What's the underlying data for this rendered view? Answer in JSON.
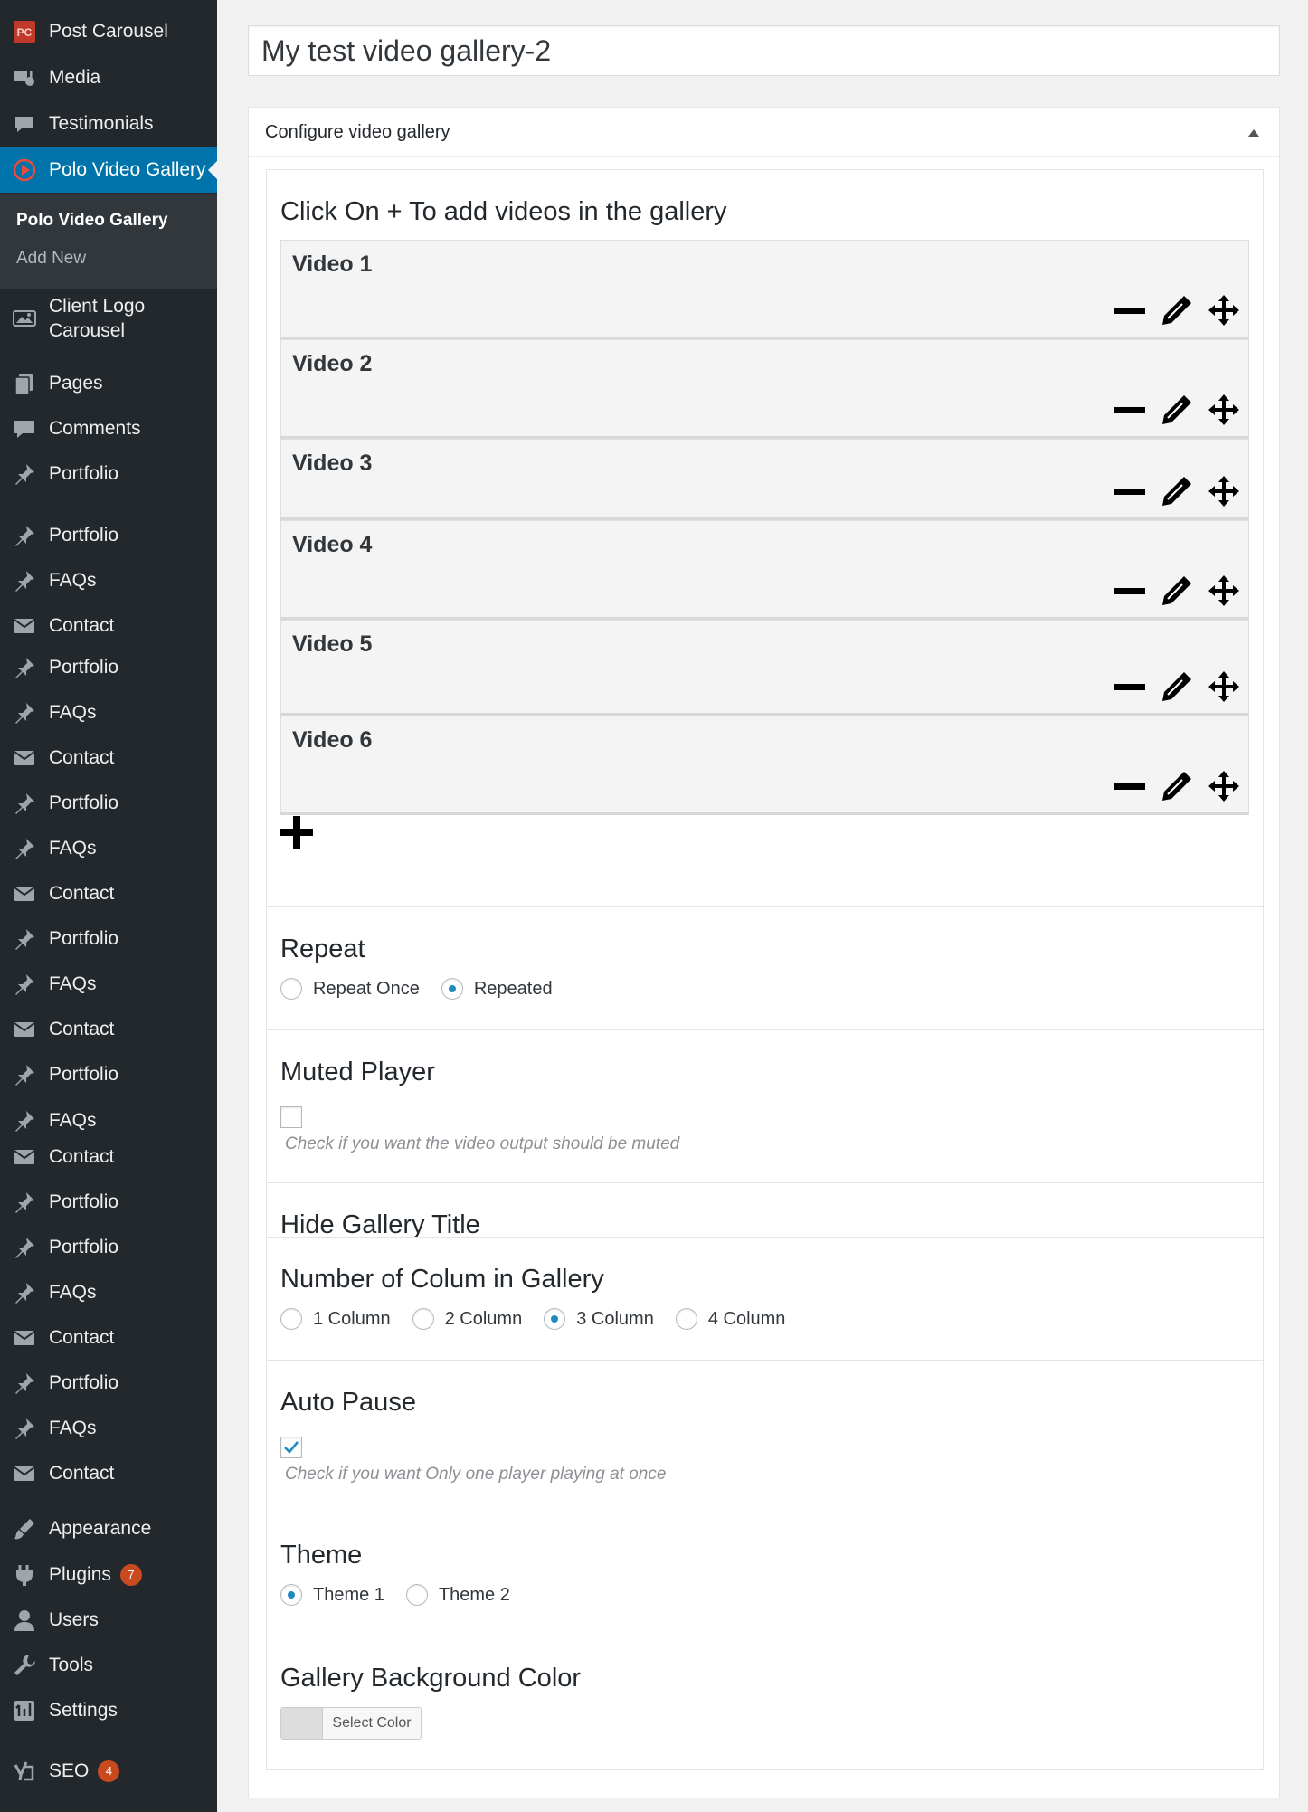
{
  "sidebar": {
    "items": [
      {
        "label": "Post Carousel",
        "icon": "pc-logo-icon"
      },
      {
        "label": "Media",
        "icon": "media-icon"
      },
      {
        "label": "Testimonials",
        "icon": "testimonials-icon"
      },
      {
        "label": "Polo Video Gallery",
        "icon": "play-circle-icon",
        "active": true
      },
      {
        "label": "Client Logo Carousel",
        "icon": "image-gallery-icon"
      },
      {
        "label": "Pages",
        "icon": "pages-icon"
      },
      {
        "label": "Comments",
        "icon": "comment-icon"
      },
      {
        "label": "Portfolio",
        "icon": "pin-icon"
      },
      {
        "label": "Portfolio",
        "icon": "pin-icon"
      },
      {
        "label": "FAQs",
        "icon": "pin-icon"
      },
      {
        "label": "Contact",
        "icon": "mail-icon"
      },
      {
        "label": "Portfolio",
        "icon": "pin-icon"
      },
      {
        "label": "FAQs",
        "icon": "pin-icon"
      },
      {
        "label": "Contact",
        "icon": "mail-icon"
      },
      {
        "label": "Portfolio",
        "icon": "pin-icon"
      },
      {
        "label": "FAQs",
        "icon": "pin-icon"
      },
      {
        "label": "Contact",
        "icon": "mail-icon"
      },
      {
        "label": "Portfolio",
        "icon": "pin-icon"
      },
      {
        "label": "FAQs",
        "icon": "pin-icon"
      },
      {
        "label": "Contact",
        "icon": "mail-icon"
      },
      {
        "label": "Portfolio",
        "icon": "pin-icon"
      },
      {
        "label": "FAQs",
        "icon": "pin-icon"
      },
      {
        "label": "Contact",
        "icon": "mail-icon"
      },
      {
        "label": "Portfolio",
        "icon": "pin-icon"
      },
      {
        "label": "Portfolio",
        "icon": "pin-icon"
      },
      {
        "label": "FAQs",
        "icon": "pin-icon"
      },
      {
        "label": "Contact",
        "icon": "mail-icon"
      },
      {
        "label": "Portfolio",
        "icon": "pin-icon"
      },
      {
        "label": "FAQs",
        "icon": "pin-icon"
      },
      {
        "label": "Contact",
        "icon": "mail-icon"
      },
      {
        "label": "Appearance",
        "icon": "brush-icon"
      },
      {
        "label": "Plugins",
        "icon": "plugin-icon",
        "badge": "7"
      },
      {
        "label": "Users",
        "icon": "user-icon"
      },
      {
        "label": "Tools",
        "icon": "wrench-icon"
      },
      {
        "label": "Settings",
        "icon": "settings-icon"
      },
      {
        "label": "SEO",
        "icon": "yoast-icon",
        "badge": "4"
      }
    ],
    "submenu": [
      {
        "label": "Polo Video Gallery",
        "current": true
      },
      {
        "label": "Add New"
      }
    ]
  },
  "post_title": "My test video gallery-2",
  "postbox": {
    "title": "Configure video gallery"
  },
  "videos": {
    "heading": "Click On + To add videos in the gallery",
    "items": [
      "Video 1",
      "Video 2",
      "Video 3",
      "Video 4",
      "Video 5",
      "Video 6"
    ]
  },
  "repeat": {
    "title": "Repeat",
    "options": [
      {
        "label": "Repeat Once",
        "checked": false
      },
      {
        "label": "Repeated",
        "checked": true
      }
    ]
  },
  "muted": {
    "title": "Muted Player",
    "checked": false,
    "help": "Check if you want the video output should be muted"
  },
  "hide_title": {
    "title": "Hide Gallery Title"
  },
  "columns": {
    "title": "Number of Colum in Gallery",
    "options": [
      {
        "label": "1 Column",
        "checked": false
      },
      {
        "label": "2 Column",
        "checked": false
      },
      {
        "label": "3 Column",
        "checked": true
      },
      {
        "label": "4 Column",
        "checked": false
      }
    ]
  },
  "auto_pause": {
    "title": "Auto Pause",
    "checked": true,
    "help": "Check if you want Only one player playing at once"
  },
  "theme": {
    "title": "Theme",
    "options": [
      {
        "label": "Theme 1",
        "checked": true
      },
      {
        "label": "Theme 2",
        "checked": false
      }
    ]
  },
  "bg_color": {
    "title": "Gallery Background Color",
    "button_label": "Select Color",
    "swatch": "#dddddd"
  },
  "colors": {
    "sidebar_bg": "#23282d",
    "accent": "#0073aa",
    "badge": "#ca4a1f"
  }
}
